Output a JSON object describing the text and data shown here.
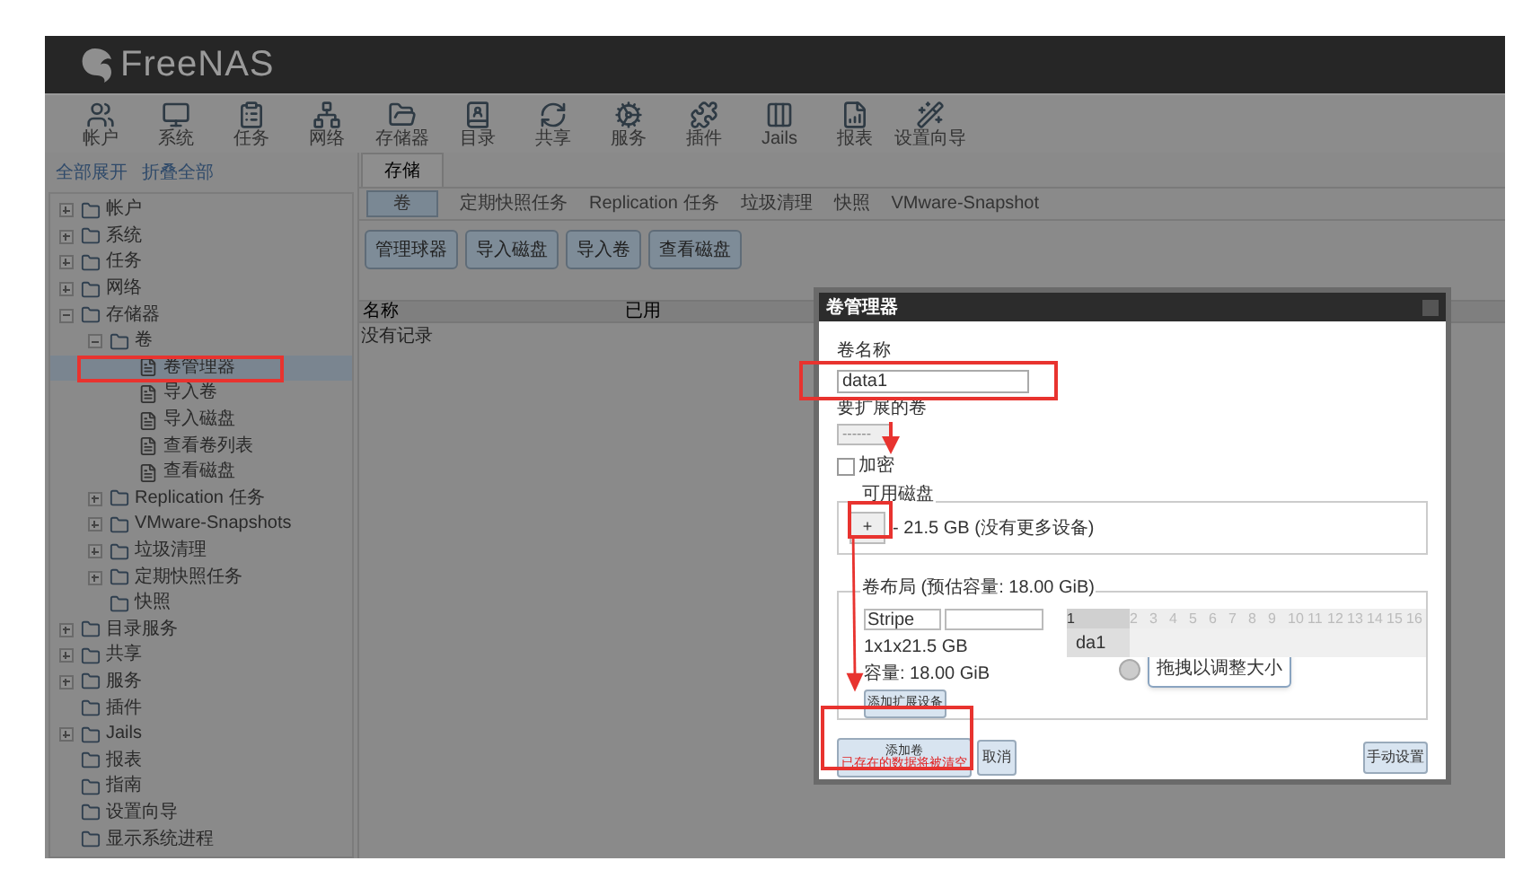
{
  "header": {
    "logo": "FreeNAS"
  },
  "toolbar": [
    "帐户",
    "系统",
    "任务",
    "网络",
    "存储器",
    "目录",
    "共享",
    "服务",
    "插件",
    "Jails",
    "报表",
    "设置向导"
  ],
  "sidebar": {
    "links": [
      "全部展开",
      "折叠全部"
    ],
    "tree": [
      {
        "label": "帐户",
        "expanded": false,
        "selected": false
      },
      {
        "label": "系统",
        "expanded": false,
        "selected": false
      },
      {
        "label": "任务",
        "expanded": false,
        "selected": false
      },
      {
        "label": "网络",
        "expanded": false,
        "selected": false
      },
      {
        "label": "存储器",
        "expanded": true,
        "selected": false,
        "children": [
          {
            "label": "卷",
            "expanded": true,
            "selected": false,
            "children": [
              {
                "label": "卷管理器",
                "selected": true
              },
              {
                "label": "导入卷",
                "selected": false
              },
              {
                "label": "导入磁盘",
                "selected": false
              },
              {
                "label": "查看卷列表",
                "selected": false
              },
              {
                "label": "查看磁盘",
                "selected": false
              }
            ]
          },
          {
            "label": "Replication 任务",
            "expanded": false,
            "selected": false
          },
          {
            "label": "VMware-Snapshots",
            "expanded": false,
            "selected": false
          },
          {
            "label": "垃圾清理",
            "expanded": false,
            "selected": false
          },
          {
            "label": "定期快照任务",
            "expanded": false,
            "selected": false
          },
          {
            "label": "快照",
            "selected": false
          }
        ]
      },
      {
        "label": "目录服务",
        "expanded": false,
        "selected": false
      },
      {
        "label": "共享",
        "expanded": false,
        "selected": false
      },
      {
        "label": "服务",
        "expanded": false,
        "selected": false
      },
      {
        "label": "插件",
        "selected": false
      },
      {
        "label": "Jails",
        "expanded": false,
        "selected": false
      },
      {
        "label": "报表",
        "selected": false
      },
      {
        "label": "指南",
        "selected": false
      },
      {
        "label": "设置向导",
        "selected": false
      },
      {
        "label": "显示系统进程",
        "selected": false
      }
    ]
  },
  "main": {
    "tabs": [
      {
        "label": "存储",
        "selected": true
      }
    ],
    "subtabs": [
      {
        "label": "卷",
        "selected": true
      },
      {
        "label": "定期快照任务",
        "selected": false
      },
      {
        "label": "Replication 任务",
        "selected": false
      },
      {
        "label": "垃圾清理",
        "selected": false
      },
      {
        "label": "快照",
        "selected": false
      },
      {
        "label": "VMware-Snapshot",
        "selected": false
      }
    ],
    "buttons": [
      "管理球器",
      "导入磁盘",
      "导入卷",
      "查看磁盘"
    ],
    "table": {
      "columns": [
        "名称",
        "已用"
      ],
      "empty": "没有记录"
    }
  },
  "dialog": {
    "title": "卷管理器",
    "name_label": "卷名称",
    "name_value": "data1",
    "extend_label": "要扩展的卷",
    "extend_value": "------",
    "encrypt": {
      "label": "加密",
      "checked": false
    },
    "disks": {
      "legend": "可用磁盘",
      "button": "+",
      "info": "- 21.5 GB (没有更多设备)"
    },
    "layout": {
      "legend": "卷布局 (预估容量: 18.00 GiB)",
      "type": "Stripe",
      "size": "1x1x21.5 GB",
      "capacity": "容量: 18.00 GiB",
      "add_button": "添加扩展设备",
      "columns": [
        "1",
        "2",
        "3",
        "4",
        "5",
        "6",
        "7",
        "8",
        "9",
        "10",
        "11",
        "12",
        "13",
        "14",
        "15",
        "16"
      ],
      "disk": "da1",
      "hint": "拖拽以调整大小"
    },
    "add_button": {
      "label": "添加卷",
      "warning": "已存在的数据将被清空"
    },
    "cancel": "取消",
    "manual": "手动设置"
  }
}
